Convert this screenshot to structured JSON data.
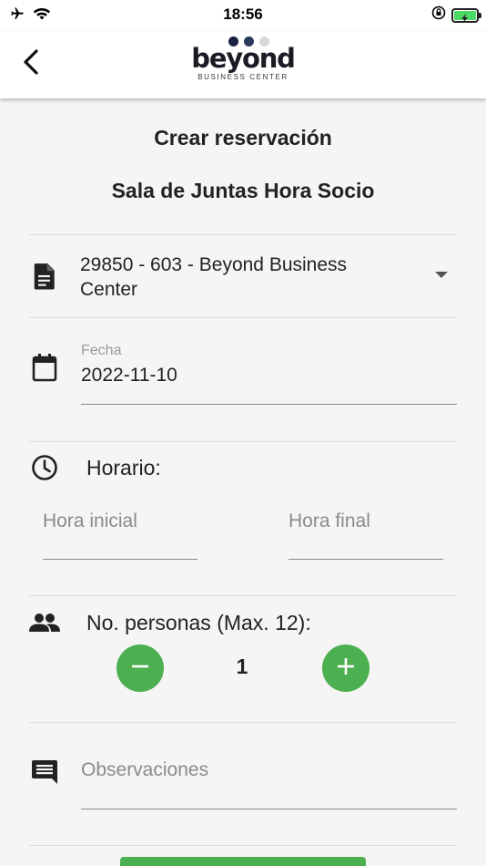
{
  "status_bar": {
    "time": "18:56",
    "icons": [
      "airplane-icon",
      "wifi-icon",
      "orientation-lock-icon",
      "battery-charging-icon"
    ],
    "battery_color": "#4cd964"
  },
  "header": {
    "back_icon": "chevron-left-icon",
    "logo": {
      "word": "beyond",
      "subtitle": "BUSINESS CENTER",
      "dot_colors": [
        "#1a2240",
        "#2a3a5e",
        "#d8d8d8"
      ]
    }
  },
  "page": {
    "title": "Crear reservación",
    "room_name": "Sala de Juntas Hora Socio"
  },
  "form": {
    "membership": {
      "icon": "document-icon",
      "selected_value": "29850 - 603 - Beyond Business Center"
    },
    "date": {
      "icon": "calendar-icon",
      "label": "Fecha",
      "value": "2022-11-10"
    },
    "schedule": {
      "icon": "clock-icon",
      "label": "Horario:",
      "start_placeholder": "Hora inicial",
      "end_placeholder": "Hora final"
    },
    "people": {
      "icon": "people-icon",
      "label": "No. personas (Max. 12):",
      "value": "1",
      "decrement_icon": "minus-icon",
      "increment_icon": "plus-icon"
    },
    "notes": {
      "icon": "comment-icon",
      "placeholder": "Observaciones"
    }
  },
  "colors": {
    "accent_green": "#4caf50",
    "background": "#f5f5f5",
    "header_bg": "#ffffff"
  }
}
